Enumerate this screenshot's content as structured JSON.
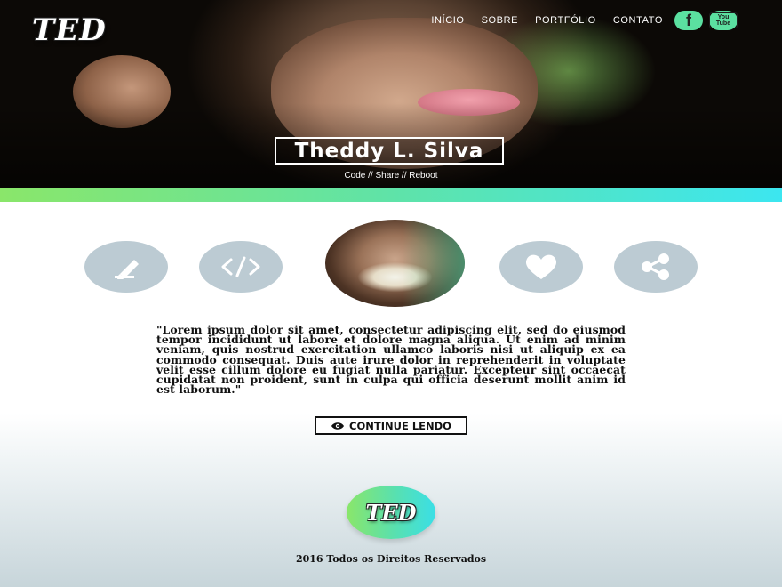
{
  "header": {
    "logo": "TED",
    "nav": [
      "INÍCIO",
      "SOBRE",
      "PORTFÓLIO",
      "CONTATO"
    ],
    "social": [
      {
        "name": "facebook-icon",
        "glyph": "f"
      },
      {
        "name": "youtube-icon",
        "glyph": "You Tube"
      }
    ]
  },
  "hero": {
    "name": "Theddy L. Silva",
    "tagline": "Code // Share // Reboot"
  },
  "features": {
    "icons": [
      "pencil-icon",
      "code-icon",
      "heart-icon",
      "share-icon"
    ]
  },
  "main": {
    "quote": "\"Lorem ipsum dolor sit amet, consectetur adipiscing elit, sed do eiusmod tempor incididunt ut labore et dolore magna aliqua. Ut enim ad minim veniam, quis nostrud exercitation ullamco laboris nisi ut aliquip ex ea commodo consequat. Duis aute irure dolor in reprehenderit in voluptate velit esse cillum dolore eu fugiat nulla pariatur. Excepteur sint occaecat cupidatat non proident, sunt in culpa qui officia deserunt mollit anim id est laborum.\"",
    "continue_label": "CONTINUE LENDO"
  },
  "footer": {
    "logo": "TED",
    "copyright": "2016 Todos os Direitos Reservados"
  },
  "colors": {
    "accent_green": "#8ae66a",
    "accent_cyan": "#3ce6f0",
    "icon_circle": "#bccbd3",
    "social_bg": "#5be0a0"
  }
}
